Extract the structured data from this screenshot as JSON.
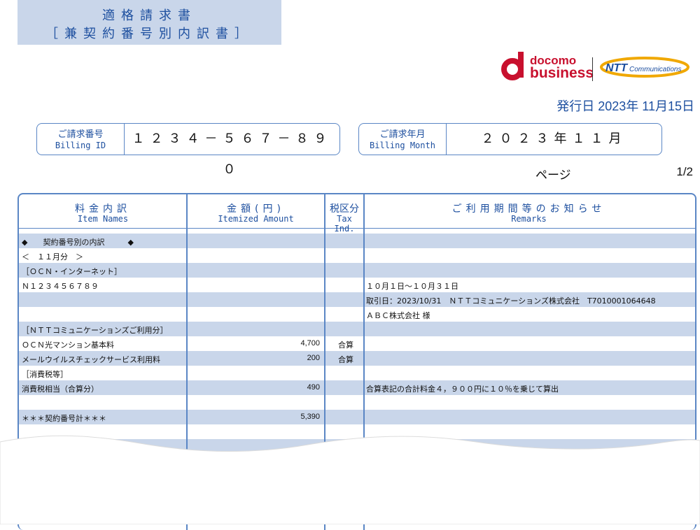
{
  "title": {
    "line1": "適格請求書",
    "line2": "［兼契約番号別内訳書］"
  },
  "brand": {
    "docomo": "docomo",
    "business": "business",
    "ntt": "NTT",
    "communications": "Communications",
    "docomo_color": "#c8102e",
    "ntt_color": "#1d4f9f",
    "ntt_ring_color": "#f0a800"
  },
  "issue_date": "発行日 2023年 11月15日",
  "billing_id": {
    "label_jp": "ご請求番号",
    "label_en": "Billing ID",
    "value": "１２３４－５６７－８９０"
  },
  "billing_month": {
    "label_jp": "ご請求年月",
    "label_en": "Billing Month",
    "value": "２０２３年１１月"
  },
  "page": {
    "label": "ページ",
    "value": "1/2"
  },
  "table": {
    "headers": {
      "item_jp": "料金内訳",
      "item_en": "Item Names",
      "amount_jp": "金額(円)",
      "amount_en": "Itemized Amount",
      "tax_jp": "税区分",
      "tax_en": "Tax Ind.",
      "remarks_jp": "ご利用期間等のお知らせ",
      "remarks_en": "Remarks"
    },
    "rows": [
      {
        "item": "◆　　契約番号別の内訳　　　◆",
        "amount": "",
        "tax": "",
        "remarks": ""
      },
      {
        "item": "＜　１１月分　＞",
        "amount": "",
        "tax": "",
        "remarks": ""
      },
      {
        "item": "［ＯＣＮ・インターネット］",
        "amount": "",
        "tax": "",
        "remarks": ""
      },
      {
        "item": "Ｎ１２３４５６７８９",
        "amount": "",
        "tax": "",
        "remarks": "１０月１日～１０月３１日"
      },
      {
        "item": "",
        "amount": "",
        "tax": "",
        "remarks": "取引日：2023/10/31　ＮＴＴコミュニケーションズ株式会社　T7010001064648"
      },
      {
        "item": "",
        "amount": "",
        "tax": "",
        "remarks": "ＡＢＣ株式会社 様"
      },
      {
        "item": "［ＮＴＴコミュニケーションズご利用分］",
        "amount": "",
        "tax": "",
        "remarks": ""
      },
      {
        "item": "ＯＣＮ光マンション基本料",
        "amount": "4,700",
        "tax": "合算",
        "remarks": ""
      },
      {
        "item": "メールウイルスチェックサービス利用料",
        "amount": "200",
        "tax": "合算",
        "remarks": ""
      },
      {
        "item": "［消費税等］",
        "amount": "",
        "tax": "",
        "remarks": ""
      },
      {
        "item": "消費税相当（合算分）",
        "amount": "490",
        "tax": "",
        "remarks": "合算表記の合計料金４，９００円に１０％を乗じて算出"
      },
      {
        "item": "",
        "amount": "",
        "tax": "",
        "remarks": ""
      },
      {
        "item": "＊＊＊契約番号計＊＊＊",
        "amount": "5,390",
        "tax": "",
        "remarks": ""
      },
      {
        "item": "",
        "amount": "",
        "tax": "",
        "remarks": ""
      },
      {
        "item": "",
        "amount": "",
        "tax": "",
        "remarks": ""
      }
    ]
  }
}
